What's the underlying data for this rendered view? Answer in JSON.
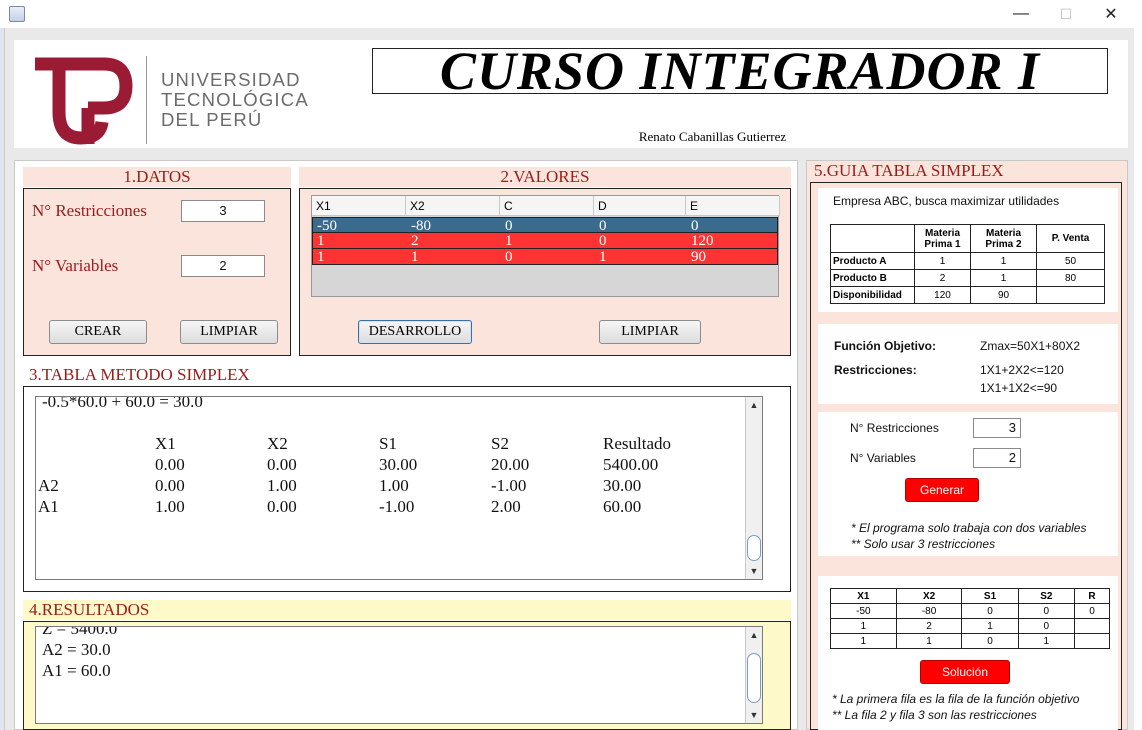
{
  "window": {
    "minimize": "—",
    "maximize": "☐",
    "close": "✕"
  },
  "header": {
    "uni_line1": "UNIVERSIDAD",
    "uni_line2": "TECNOLÓGICA",
    "uni_line3": "DEL PERÚ",
    "course_title": "CURSO INTEGRADOR I",
    "author": "Renato Cabanillas Gutierrez"
  },
  "datos": {
    "title": "1.DATOS",
    "restricciones_label": "N° Restricciones",
    "restricciones_value": "3",
    "variables_label": "N° Variables",
    "variables_value": "2",
    "crear_label": "CREAR",
    "limpiar_label": "LIMPIAR"
  },
  "valores": {
    "title": "2.VALORES",
    "columns": [
      "X1",
      "X2",
      "C",
      "D",
      "E"
    ],
    "rows": [
      [
        "-50",
        "-80",
        "0",
        "0",
        "0"
      ],
      [
        "1",
        "2",
        "1",
        "0",
        "120"
      ],
      [
        "1",
        "1",
        "0",
        "1",
        "90"
      ]
    ],
    "desarrollo_label": "DESARROLLO",
    "limpiar_label": "LIMPIAR"
  },
  "tabla": {
    "title": "3.TABLA METODO SIMPLEX",
    "partial_line": "-0.5*60.0 + 60.0 = 30.0",
    "headers": [
      "X1",
      "X2",
      "S1",
      "S2",
      "Resultado"
    ],
    "rows": [
      {
        "label": "",
        "values": [
          "0.00",
          "0.00",
          "30.00",
          "20.00",
          "5400.00"
        ]
      },
      {
        "label": "A2",
        "values": [
          "0.00",
          "1.00",
          "1.00",
          "-1.00",
          "30.00"
        ]
      },
      {
        "label": "A1",
        "values": [
          "1.00",
          "0.00",
          "-1.00",
          "2.00",
          "60.00"
        ]
      }
    ]
  },
  "resultados": {
    "title": "4.RESULTADOS",
    "lines": [
      "Z = 5400.0",
      "A2 = 30.0",
      "A1 = 60.0"
    ]
  },
  "guia": {
    "title": "5.GUIA TABLA SIMPLEX",
    "empresa": "Empresa ABC, busca maximizar utilidades",
    "table_headers": [
      "",
      "Materia Prima 1",
      "Materia Prima 2",
      "P. Venta"
    ],
    "table_rows": [
      [
        "Producto A",
        "1",
        "1",
        "50"
      ],
      [
        "Producto B",
        "2",
        "1",
        "80"
      ],
      [
        "Disponibilidad",
        "120",
        "90",
        ""
      ]
    ],
    "funcion_label": "Función Objetivo:",
    "funcion_value": "Zmax=50X1+80X2",
    "restricciones_label": "Restricciones:",
    "restriccion_1": "1X1+2X2<=120",
    "restriccion_2": "1X1+1X2<=90",
    "n_restricciones_label": "N° Restricciones",
    "n_restricciones_value": "3",
    "n_variables_label": "N° Variables",
    "n_variables_value": "2",
    "generar_label": "Generar",
    "note_1": "* El programa solo trabaja con dos variables",
    "note_2": "** Solo usar 3 restricciones",
    "sol_headers": [
      "X1",
      "X2",
      "S1",
      "S2",
      "R"
    ],
    "sol_rows": [
      [
        "-50",
        "-80",
        "0",
        "0",
        "0"
      ],
      [
        "1",
        "2",
        "1",
        "0",
        ""
      ],
      [
        "1",
        "1",
        "0",
        "1",
        ""
      ]
    ],
    "solucion_label": "Solución",
    "note_3": "* La primera fila es la fila de la función objetivo",
    "note_4": "** La fila 2 y fila 3 son las restricciones"
  },
  "colors": {
    "brand_red": "#9b1b1b",
    "panel_pink": "#fbe4dc",
    "results_yellow": "#fdf9c9",
    "grid_selected": "#3b6b8c",
    "grid_red": "#ff3333"
  }
}
